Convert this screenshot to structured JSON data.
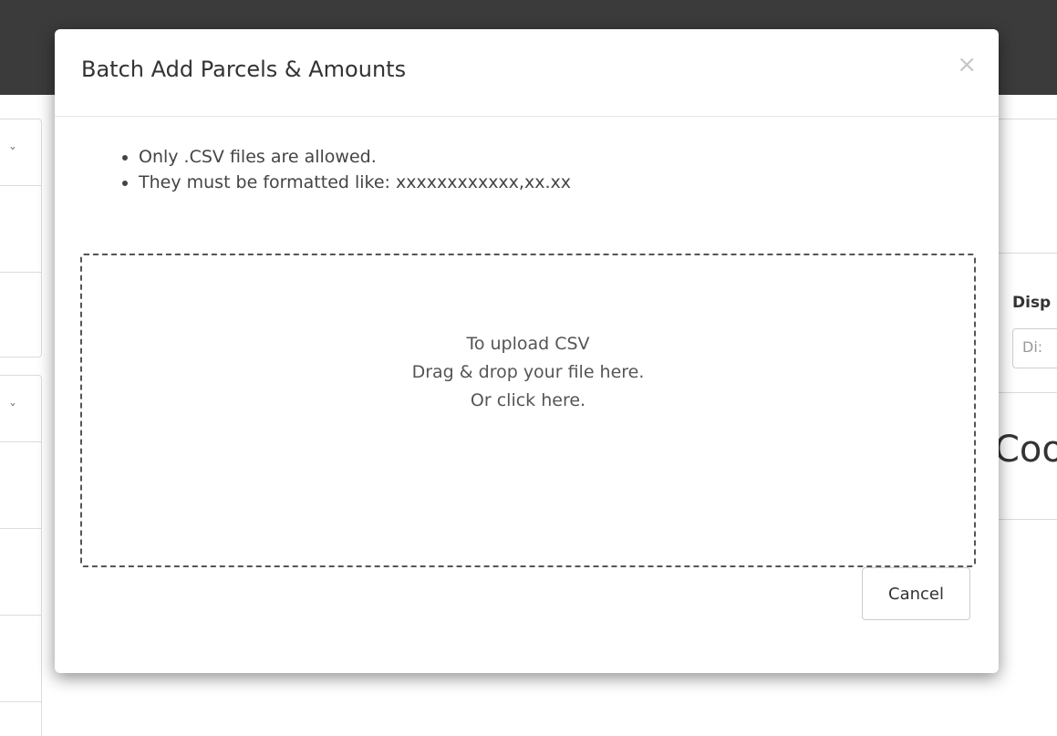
{
  "background": {
    "display_label": "Disp",
    "display_placeholder": "Di:",
    "heading_fragment": "Coo",
    "caret_glyph": "ˇ"
  },
  "modal": {
    "title": "Batch Add Parcels & Amounts",
    "close_glyph": "×",
    "rules": [
      "Only .CSV files are allowed.",
      "They must be formatted like: xxxxxxxxxxxx,xx.xx"
    ],
    "dropzone": {
      "line1": "To upload CSV",
      "line2": "Drag & drop your file here.",
      "line3": "Or click here."
    },
    "cancel_label": "Cancel"
  },
  "colors": {
    "topbar": "#3b3b3b",
    "dropzone_border": "#555555",
    "close_icon": "#c6c6c6"
  }
}
